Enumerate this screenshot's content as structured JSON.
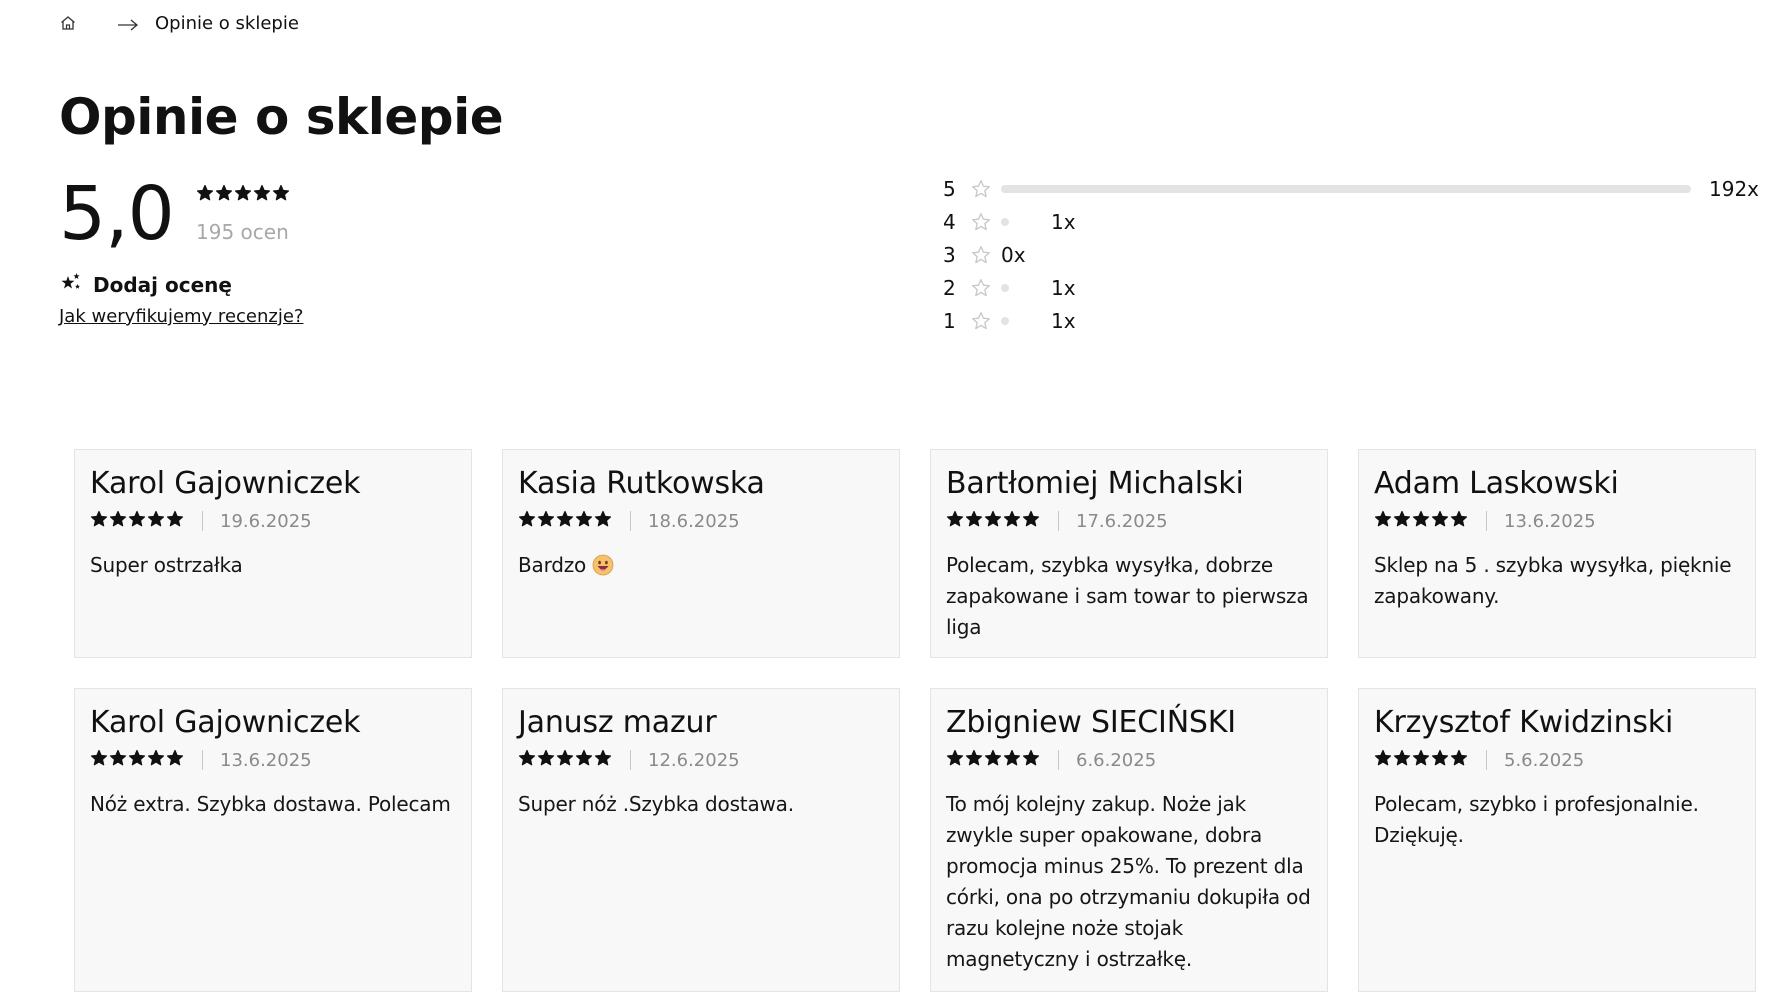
{
  "breadcrumb": {
    "home_icon": "home-icon",
    "separator_icon": "arrow-right-icon",
    "current": "Opinie o sklepie"
  },
  "page": {
    "title": "Opinie o sklepie"
  },
  "summary": {
    "average": "5,0",
    "rating": 5,
    "count_text": "195 ocen",
    "add_rating_label": "Dodaj ocenę",
    "add_rating_icon": "stars-sparkle-icon",
    "verify_link": "Jak weryfikujemy recenzje?"
  },
  "distribution": [
    {
      "stars": "5",
      "count": 192,
      "count_text": "192x"
    },
    {
      "stars": "4",
      "count": 1,
      "count_text": "1x"
    },
    {
      "stars": "3",
      "count": 0,
      "count_text": "0x"
    },
    {
      "stars": "2",
      "count": 1,
      "count_text": "1x"
    },
    {
      "stars": "1",
      "count": 1,
      "count_text": "1x"
    }
  ],
  "reviews": [
    {
      "name": "Karol Gajowniczek",
      "rating": 5,
      "date": "19.6.2025",
      "text": "Super ostrzałka",
      "emoji": ""
    },
    {
      "name": "Kasia Rutkowska",
      "rating": 5,
      "date": "18.6.2025",
      "text": "Bardzo",
      "emoji": "grinning-face-emoji"
    },
    {
      "name": "Bartłomiej Michalski",
      "rating": 5,
      "date": "17.6.2025",
      "text": "Polecam, szybka wysyłka, dobrze zapakowane i sam towar to pierwsza liga",
      "emoji": ""
    },
    {
      "name": "Adam Laskowski",
      "rating": 5,
      "date": "13.6.2025",
      "text": "Sklep na 5 . szybka wysyłka, pięknie zapakowany.",
      "emoji": ""
    },
    {
      "name": "Karol Gajowniczek",
      "rating": 5,
      "date": "13.6.2025",
      "text": "Nóż extra. Szybka dostawa. Polecam",
      "emoji": ""
    },
    {
      "name": "Janusz mazur",
      "rating": 5,
      "date": "12.6.2025",
      "text": "Super nóż .Szybka dostawa.",
      "emoji": ""
    },
    {
      "name": "Zbigniew SIECIŃSKI",
      "rating": 5,
      "date": "6.6.2025",
      "text": "To mój kolejny zakup. Noże jak zwykle super opakowane, dobra promocja minus 25%. To prezent dla córki, ona po otrzymaniu dokupiła od razu kolejne noże stojak magnetyczny i ostrzałkę.",
      "emoji": ""
    },
    {
      "name": "Krzysztof Kwidzinski",
      "rating": 5,
      "date": "5.6.2025",
      "text": "Polecam, szybko i profesjonalnie. Dziękuję.",
      "emoji": ""
    }
  ],
  "colors": {
    "star_filled": "#111111",
    "star_outline": "#c8c8c8",
    "bar": "#e3e3e3",
    "card_bg": "#f8f8f8",
    "muted_text": "#8a8a8a"
  }
}
